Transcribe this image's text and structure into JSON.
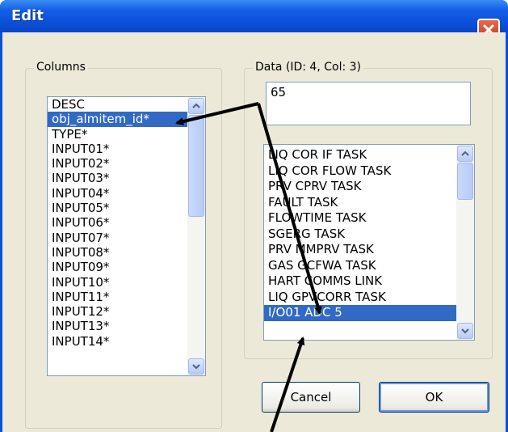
{
  "window": {
    "title": "Edit"
  },
  "columns_group": {
    "label": "Columns",
    "items": [
      "DESC",
      "obj_almitem_id*",
      "TYPE*",
      "INPUT01*",
      "INPUT02*",
      "INPUT03*",
      "INPUT04*",
      "INPUT05*",
      "INPUT06*",
      "INPUT07*",
      "INPUT08*",
      "INPUT09*",
      "INPUT10*",
      "INPUT11*",
      "INPUT12*",
      "INPUT13*",
      "INPUT14*"
    ],
    "selected_index": 1
  },
  "data_group": {
    "label": "Data (ID: 4, Col: 3)",
    "value": "65",
    "options": [
      "LIQ COR IF TASK",
      "LIQ COR FLOW TASK",
      "PRV CPRV TASK",
      "FAULT TASK",
      "FLOWTIME TASK",
      "SGERG TASK",
      "PRV MMPRV TASK",
      "GAS GCFWA TASK",
      "HART COMMS LINK",
      "LIQ GPVCORR TASK",
      "I/O01 ADC 5"
    ],
    "selected_index": 10
  },
  "buttons": {
    "cancel": "Cancel",
    "ok": "OK"
  },
  "icons": {
    "close": "close-icon",
    "scroll_up": "scroll-up-arrow-icon",
    "scroll_down": "scroll-down-arrow-icon"
  },
  "colors": {
    "selection": "#316ac5",
    "titlebar": "#0a50d8",
    "dialog_bg": "#ece9d8"
  }
}
